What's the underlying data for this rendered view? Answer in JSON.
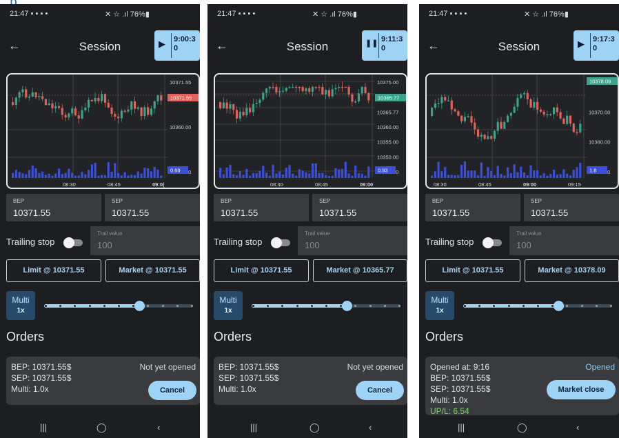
{
  "phones": [
    {
      "status_time": "21:47 ▪ ▪ ▪ •",
      "status_right": "✕ ☆ .ıl 76%▮",
      "title": "Session",
      "play_icon": "play-icon",
      "play_symbol": "▶",
      "timer": "9:00:3\n0",
      "chart": {
        "price_labels": [
          "10371.55",
          "10360.00",
          "10350.00"
        ],
        "price_tag": "10371.55",
        "volume_tag": "0.69",
        "time_labels": [
          "08:30",
          "08:45",
          "09:0("
        ]
      },
      "bep_label": "BEP",
      "bep_value": "10371.55",
      "sep_label": "SEP",
      "sep_value": "10371.55",
      "trailing_label": "Trailing stop",
      "trail_label": "Trail value",
      "trail_value": "100",
      "limit_btn": "Limit @ 10371.55",
      "market_btn": "Market @ 10371.55",
      "multi_label": "Multi",
      "multi_value": "1x",
      "multi_level": 0.64,
      "orders_heading": "Orders",
      "order": {
        "lines": [
          "BEP: 10371.55$",
          "SEP: 10371.55$",
          "Multi: 1.0x"
        ],
        "status": "Not yet opened",
        "action": "Cancel"
      },
      "nav": [
        "|||",
        "◯",
        "‹"
      ]
    },
    {
      "status_time": "21:47 ▪ ▪ ▪ •",
      "status_right": "✕ ☆ .ıl 76%▮",
      "title": "Session",
      "play_icon": "pause-icon",
      "play_symbol": "❚❚",
      "timer": "9:11:3\n0",
      "chart": {
        "price_labels": [
          "10375.00",
          "10370.00",
          "10365.77",
          "10360.00",
          "10355.00",
          "10350.00",
          "10345.00"
        ],
        "price_tag": "10365.77",
        "volume_tag": "0.93",
        "time_labels": [
          "08:30",
          "08:45",
          "09:00"
        ]
      },
      "bep_label": "BEP",
      "bep_value": "10371.55",
      "sep_label": "SEP",
      "sep_value": "10371.55",
      "trailing_label": "Trailing stop",
      "trail_label": "Trail value",
      "trail_value": "100",
      "limit_btn": "Limit @ 10371.55",
      "market_btn": "Market @ 10365.77",
      "multi_label": "Multi",
      "multi_value": "1x",
      "multi_level": 0.64,
      "orders_heading": "Orders",
      "order": {
        "lines": [
          "BEP: 10371.55$",
          "SEP: 10371.55$",
          "Multi: 1.0x"
        ],
        "status": "Not yet opened",
        "action": "Cancel"
      },
      "nav": [
        "|||",
        "◯",
        "‹"
      ]
    },
    {
      "status_time": "21:47 ▪ ▪ ▪ •",
      "status_right": "✕ ☆ .ıl 76%▮",
      "title": "Session",
      "play_icon": "play-icon",
      "play_symbol": "▶",
      "timer": "9:17:3\n0",
      "chart": {
        "price_labels": [
          "10378.09",
          "10370.00",
          "10360.00",
          "10350.00"
        ],
        "price_tag": "10378.09",
        "volume_tag": "1.8",
        "time_labels": [
          "08:30",
          "08:45",
          "09:00",
          "09:15"
        ]
      },
      "bep_label": "BEP",
      "bep_value": "10371.55",
      "sep_label": "SEP",
      "sep_value": "10371.55",
      "trailing_label": "Trailing stop",
      "trail_label": "Trail value",
      "trail_value": "100",
      "limit_btn": "Limit @ 10371.55",
      "market_btn": "Market @ 10378.09",
      "multi_label": "Multi",
      "multi_value": "1x",
      "multi_level": 0.64,
      "orders_heading": "Orders",
      "order": {
        "lines": [
          "Opened at: 9:16",
          "BEP: 10371.55$",
          "SEP: 10371.55$",
          "Multi: 1.0x",
          "UP/L: 6.54"
        ],
        "status": "Opened",
        "action": "Market close"
      },
      "nav": [
        "|||",
        "◯",
        "‹"
      ]
    }
  ],
  "colors": {
    "background": "#1d1e21",
    "accent": "#9fd3f5",
    "candle_up": "#3aa38a",
    "candle_down": "#e0625a",
    "volume": "#3b4fd8",
    "pnl_positive": "#7ed36a"
  }
}
